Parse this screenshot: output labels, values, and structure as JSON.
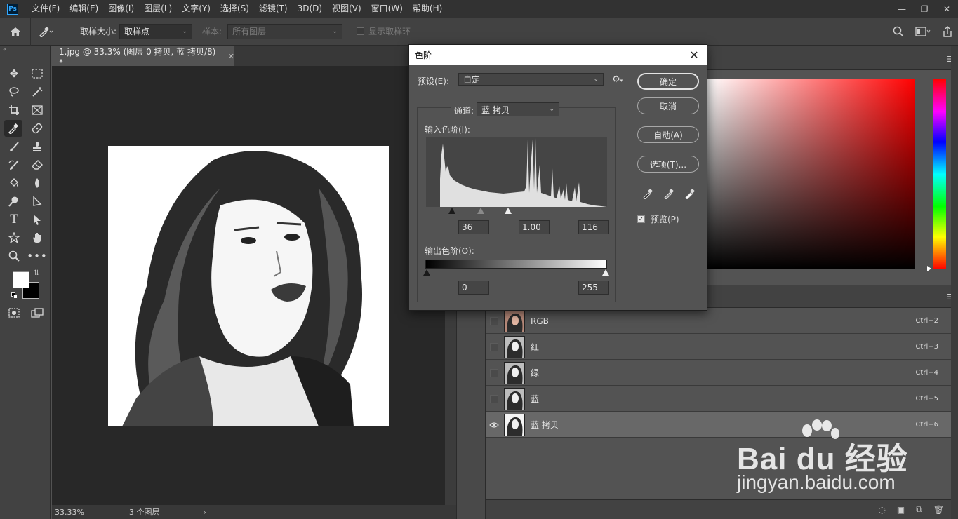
{
  "app": {
    "logo": "Ps",
    "menu": [
      "文件(F)",
      "编辑(E)",
      "图像(I)",
      "图层(L)",
      "文字(Y)",
      "选择(S)",
      "滤镜(T)",
      "3D(D)",
      "视图(V)",
      "窗口(W)",
      "帮助(H)"
    ]
  },
  "options": {
    "sample_size_label": "取样大小:",
    "sample_size_value": "取样点",
    "sample_label": "样本:",
    "sample_value": "所有图层",
    "show_ring_label": "显示取样环"
  },
  "document": {
    "tab_title": "1.jpg @ 33.3% (图层 0 拷贝, 蓝 拷贝/8) *",
    "zoom": "33.33%",
    "layers_info": "3 个图层"
  },
  "colors": {
    "foreground": "#ffffff",
    "background": "#000000",
    "accent": "#31a8ff"
  },
  "levels": {
    "title": "色阶",
    "preset_label": "预设(E):",
    "preset_value": "自定",
    "channel_label": "通道:",
    "channel_value": "蓝 拷贝",
    "input_label": "输入色阶(I):",
    "input_black": "36",
    "input_gamma": "1.00",
    "input_white": "116",
    "output_label": "输出色阶(O):",
    "output_black": "0",
    "output_white": "255",
    "ok": "确定",
    "cancel": "取消",
    "auto": "自动(A)",
    "options": "选项(T)...",
    "preview": "预览(P)",
    "preview_checked": true
  },
  "channels": [
    {
      "name": "RGB",
      "shortcut": "Ctrl+2",
      "visible": false,
      "selected": false
    },
    {
      "name": "红",
      "shortcut": "Ctrl+3",
      "visible": false,
      "selected": false
    },
    {
      "name": "绿",
      "shortcut": "Ctrl+4",
      "visible": false,
      "selected": false
    },
    {
      "name": "蓝",
      "shortcut": "Ctrl+5",
      "visible": false,
      "selected": false
    },
    {
      "name": "蓝 拷贝",
      "shortcut": "Ctrl+6",
      "visible": true,
      "selected": true
    }
  ],
  "watermark": {
    "brand": "Bai du 经验",
    "url": "jingyan.baidu.com"
  }
}
